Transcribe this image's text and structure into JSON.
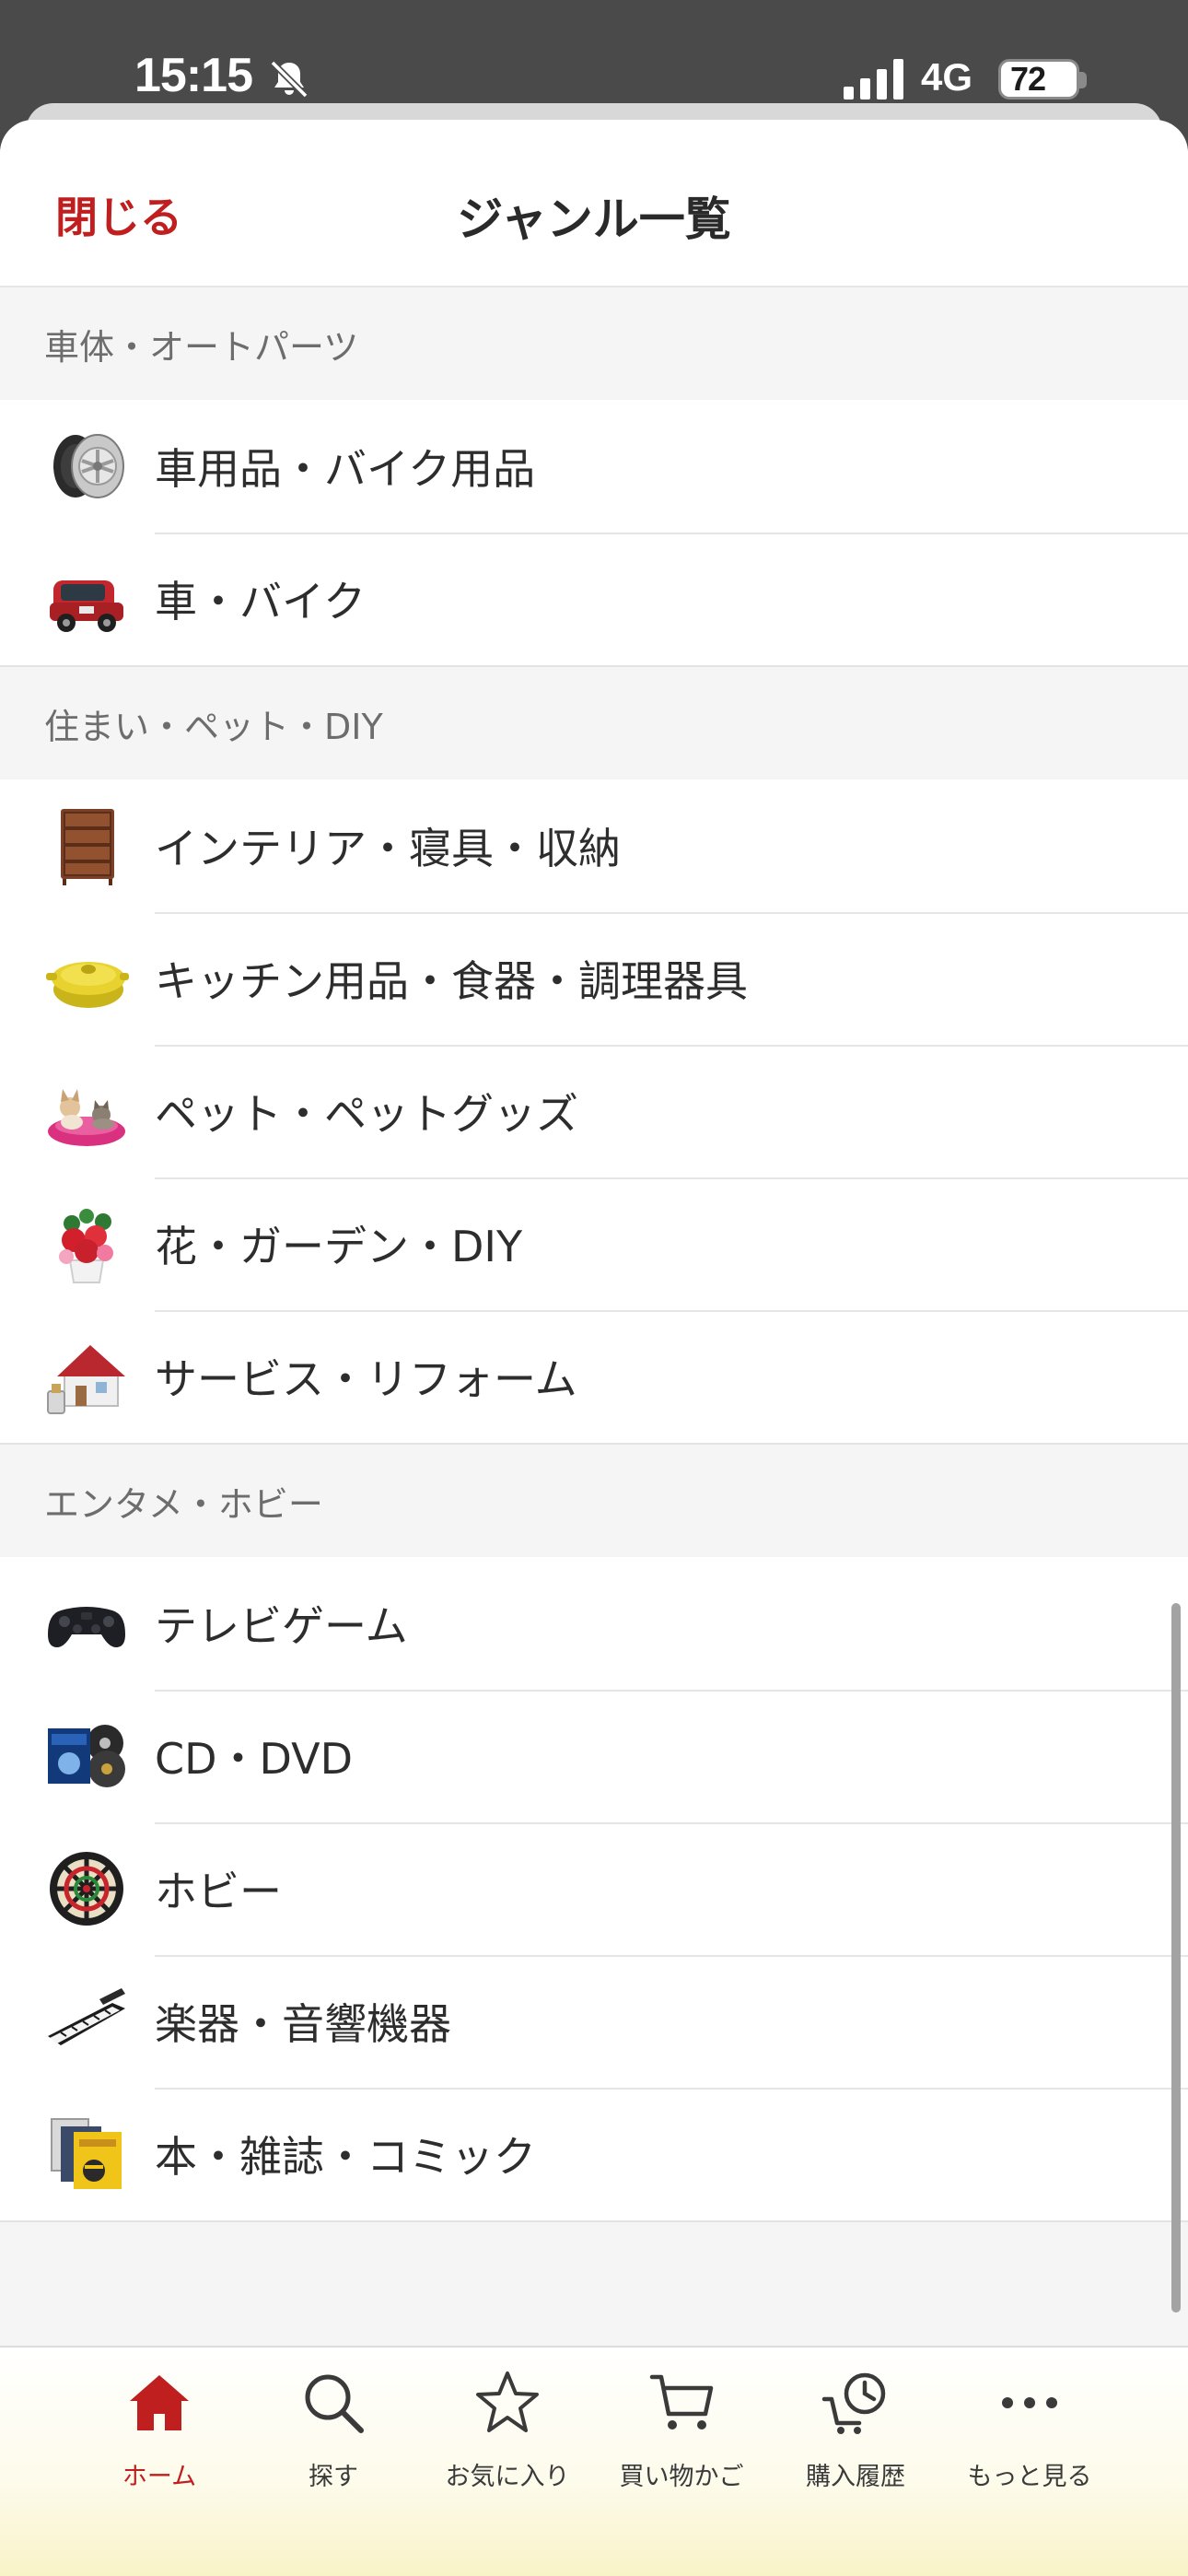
{
  "status_bar": {
    "time": "15:15",
    "network": "4G",
    "battery": "72",
    "icons": [
      "bell-slash-icon",
      "cellular-signal-icon",
      "battery-icon"
    ]
  },
  "header": {
    "close_label": "閉じる",
    "title": "ジャンル一覧"
  },
  "sections": [
    {
      "title": "車体・オートパーツ",
      "items": [
        {
          "label": "車用品・バイク用品",
          "icon": "tire-wheel-icon"
        },
        {
          "label": "車・バイク",
          "icon": "red-car-icon"
        }
      ]
    },
    {
      "title": "住まい・ペット・DIY",
      "items": [
        {
          "label": "インテリア・寝具・収納",
          "icon": "chest-of-drawers-icon"
        },
        {
          "label": "キッチン用品・食器・調理器具",
          "icon": "cooking-pot-icon"
        },
        {
          "label": "ペット・ペットグッズ",
          "icon": "pet-bed-icon"
        },
        {
          "label": "花・ガーデン・DIY",
          "icon": "flower-arrangement-icon"
        },
        {
          "label": "サービス・リフォーム",
          "icon": "house-icon"
        }
      ]
    },
    {
      "title": "エンタメ・ホビー",
      "items": [
        {
          "label": "テレビゲーム",
          "icon": "game-controller-icon"
        },
        {
          "label": "CD・DVD",
          "icon": "disc-case-icon"
        },
        {
          "label": "ホビー",
          "icon": "dartboard-icon"
        },
        {
          "label": "楽器・音響機器",
          "icon": "keyboard-piano-icon"
        },
        {
          "label": "本・雑誌・コミック",
          "icon": "books-icon"
        }
      ]
    }
  ],
  "tab_bar": {
    "tabs": [
      {
        "label": "ホーム",
        "icon": "home-icon",
        "active": true
      },
      {
        "label": "探す",
        "icon": "search-icon",
        "active": false
      },
      {
        "label": "お気に入り",
        "icon": "star-icon",
        "active": false
      },
      {
        "label": "買い物かご",
        "icon": "cart-icon",
        "active": false
      },
      {
        "label": "購入履歴",
        "icon": "purchase-history-icon",
        "active": false
      },
      {
        "label": "もっと見る",
        "icon": "more-icon",
        "active": false
      }
    ]
  },
  "colors": {
    "accent": "#bf1f1f",
    "sheet_background": "#f5f5f5",
    "status_bar_background": "#4a4a4a"
  }
}
